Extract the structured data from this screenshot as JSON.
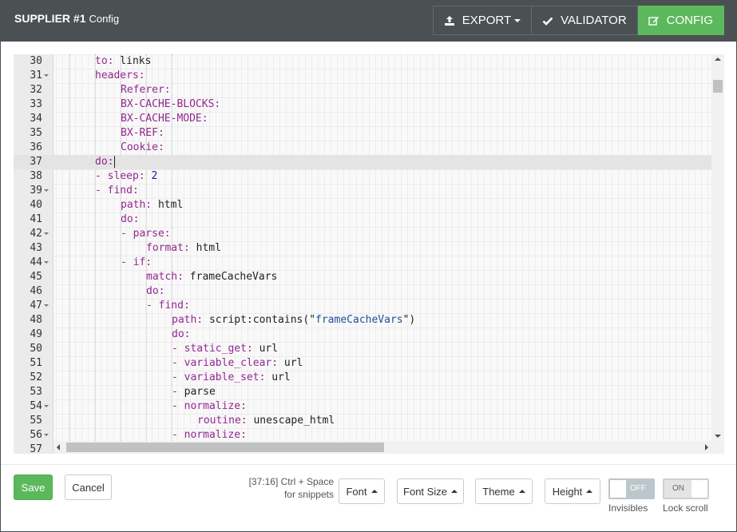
{
  "header": {
    "title_bold": "SUPPLIER #1",
    "title_sub": "Config",
    "buttons": {
      "export": "EXPORT",
      "validator": "VALIDATOR",
      "config": "CONFIG"
    },
    "colors": {
      "bar": "#4b5052",
      "active": "#5cb85c"
    }
  },
  "editor": {
    "active_line": 37,
    "lines": [
      {
        "n": "30",
        "fold": false,
        "indent": 6,
        "tokens": [
          {
            "t": "to:",
            "c": "k"
          },
          {
            "t": " links",
            "c": ""
          }
        ]
      },
      {
        "n": "31",
        "fold": true,
        "indent": 6,
        "tokens": [
          {
            "t": "headers:",
            "c": "k"
          }
        ]
      },
      {
        "n": "32",
        "fold": false,
        "indent": 10,
        "tokens": [
          {
            "t": "Referer:",
            "c": "k"
          }
        ]
      },
      {
        "n": "33",
        "fold": false,
        "indent": 10,
        "tokens": [
          {
            "t": "BX-CACHE-BLOCKS:",
            "c": "k"
          }
        ]
      },
      {
        "n": "34",
        "fold": false,
        "indent": 10,
        "tokens": [
          {
            "t": "BX-CACHE-MODE:",
            "c": "k"
          }
        ]
      },
      {
        "n": "35",
        "fold": false,
        "indent": 10,
        "tokens": [
          {
            "t": "BX-REF:",
            "c": "k"
          }
        ]
      },
      {
        "n": "36",
        "fold": false,
        "indent": 10,
        "tokens": [
          {
            "t": "Cookie:",
            "c": "k"
          }
        ]
      },
      {
        "n": "37",
        "fold": false,
        "indent": 6,
        "tokens": [
          {
            "t": "do:",
            "c": "k"
          }
        ],
        "cursor": true
      },
      {
        "n": "38",
        "fold": false,
        "indent": 6,
        "tokens": [
          {
            "t": "- sleep:",
            "c": "k"
          },
          {
            "t": " ",
            "c": ""
          },
          {
            "t": "2",
            "c": "n"
          }
        ]
      },
      {
        "n": "39",
        "fold": true,
        "indent": 6,
        "tokens": [
          {
            "t": "- find:",
            "c": "k"
          }
        ]
      },
      {
        "n": "40",
        "fold": false,
        "indent": 10,
        "tokens": [
          {
            "t": "path:",
            "c": "k"
          },
          {
            "t": " html",
            "c": ""
          }
        ]
      },
      {
        "n": "41",
        "fold": false,
        "indent": 10,
        "tokens": [
          {
            "t": "do:",
            "c": "k"
          }
        ]
      },
      {
        "n": "42",
        "fold": true,
        "indent": 10,
        "tokens": [
          {
            "t": "- parse:",
            "c": "k"
          }
        ]
      },
      {
        "n": "43",
        "fold": false,
        "indent": 14,
        "tokens": [
          {
            "t": "format:",
            "c": "k"
          },
          {
            "t": " html",
            "c": ""
          }
        ]
      },
      {
        "n": "44",
        "fold": true,
        "indent": 10,
        "tokens": [
          {
            "t": "- if:",
            "c": "k"
          }
        ]
      },
      {
        "n": "45",
        "fold": false,
        "indent": 14,
        "tokens": [
          {
            "t": "match:",
            "c": "k"
          },
          {
            "t": " frameCacheVars",
            "c": ""
          }
        ]
      },
      {
        "n": "46",
        "fold": false,
        "indent": 14,
        "tokens": [
          {
            "t": "do:",
            "c": "k"
          }
        ]
      },
      {
        "n": "47",
        "fold": true,
        "indent": 14,
        "tokens": [
          {
            "t": "- find:",
            "c": "k"
          }
        ]
      },
      {
        "n": "48",
        "fold": false,
        "indent": 18,
        "tokens": [
          {
            "t": "path:",
            "c": "k"
          },
          {
            "t": " script:contains(\"",
            "c": ""
          },
          {
            "t": "frameCacheVars",
            "c": "s"
          },
          {
            "t": "\")",
            "c": ""
          }
        ]
      },
      {
        "n": "49",
        "fold": false,
        "indent": 18,
        "tokens": [
          {
            "t": "do:",
            "c": "k"
          }
        ]
      },
      {
        "n": "50",
        "fold": false,
        "indent": 18,
        "tokens": [
          {
            "t": "- static_get:",
            "c": "k"
          },
          {
            "t": " url",
            "c": ""
          }
        ]
      },
      {
        "n": "51",
        "fold": false,
        "indent": 18,
        "tokens": [
          {
            "t": "- variable_clear:",
            "c": "k"
          },
          {
            "t": " url",
            "c": ""
          }
        ]
      },
      {
        "n": "52",
        "fold": false,
        "indent": 18,
        "tokens": [
          {
            "t": "- variable_set:",
            "c": "k"
          },
          {
            "t": " url",
            "c": ""
          }
        ]
      },
      {
        "n": "53",
        "fold": false,
        "indent": 18,
        "tokens": [
          {
            "t": "- ",
            "c": "k"
          },
          {
            "t": "parse",
            "c": ""
          }
        ]
      },
      {
        "n": "54",
        "fold": true,
        "indent": 18,
        "tokens": [
          {
            "t": "- normalize:",
            "c": "k"
          }
        ]
      },
      {
        "n": "55",
        "fold": false,
        "indent": 22,
        "tokens": [
          {
            "t": "routine:",
            "c": "k"
          },
          {
            "t": " unescape_html",
            "c": ""
          }
        ]
      },
      {
        "n": "56",
        "fold": true,
        "indent": 18,
        "tokens": [
          {
            "t": "- normalize:",
            "c": "k"
          }
        ]
      },
      {
        "n": "57",
        "fold": false,
        "indent": 22,
        "tokens": []
      }
    ]
  },
  "footer": {
    "save": "Save",
    "cancel": "Cancel",
    "status_line1": "[37:16] Ctrl + Space",
    "status_line2": "for snippets",
    "dropdowns": {
      "font": "Font",
      "font_size": "Font Size",
      "theme": "Theme",
      "height": "Height"
    },
    "toggles": {
      "invisibles": {
        "state": "OFF",
        "label": "Invisibles"
      },
      "lock_scroll": {
        "state": "ON",
        "label": "Lock scroll"
      }
    }
  }
}
